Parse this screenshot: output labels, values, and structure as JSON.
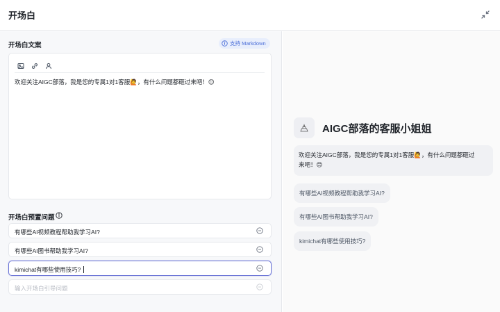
{
  "header": {
    "title": "开场白",
    "collapse_icon": "collapse-arrows-icon"
  },
  "opening": {
    "section_label": "开场白文案",
    "markdown_badge": "支持 Markdown",
    "toolbar_icons": [
      "image-icon",
      "link-icon",
      "user-icon"
    ],
    "content": "欢迎关注AIGC部落，我是您的专属1对1客服🙋，有什么问题都砸过来吧！😊"
  },
  "preset_questions": {
    "section_label": "开场白预置问题",
    "items": [
      "有哪些AI视频教程帮助我学习AI?",
      "有哪些AI图书帮助我学习AI?",
      "kimichat有哪些使用技巧?"
    ],
    "input_placeholder": "输入开场白引导问题"
  },
  "preview": {
    "bot_name": "AIGC部落的客服小姐姐",
    "welcome_line1": "欢迎关注AIGC部落，我是您的专属1对1客服🙋，有什么问题都砸过",
    "welcome_line2": "来吧！😊",
    "suggestions": [
      "有哪些AI视频教程帮助我学习AI?",
      "有哪些AI图书帮助我学习AI?",
      "kimichat有哪些使用技巧?"
    ]
  },
  "colors": {
    "accent": "#4c6fd8",
    "active_border": "#6b74d6",
    "panel_bg": "#f7f8fa",
    "bubble_bg": "#f0f1f4"
  }
}
